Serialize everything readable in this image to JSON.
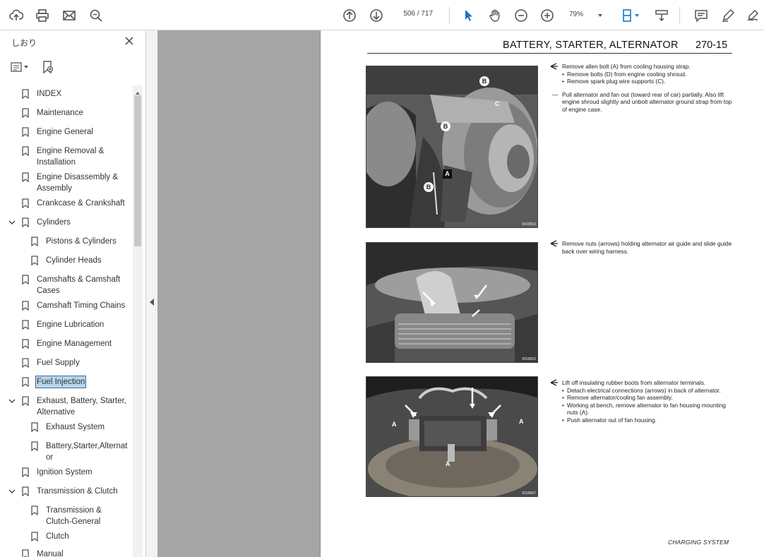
{
  "toolbar": {
    "current_page": "506",
    "total_pages": "/ 717",
    "zoom": "79%"
  },
  "sidebar": {
    "title": "しおり",
    "items": [
      {
        "label": "INDEX"
      },
      {
        "label": "Maintenance"
      },
      {
        "label": "Engine General"
      },
      {
        "label": "Engine Removal &"
      },
      {
        "label": "Installation"
      },
      {
        "label": "Engine Disassembly &"
      },
      {
        "label": "Assembly"
      },
      {
        "label": "Crankcase & Crankshaft"
      },
      {
        "label": "Cylinders"
      },
      {
        "label": "Pistons & Cylinders"
      },
      {
        "label": "Cylinder Heads"
      },
      {
        "label": "Camshafts & Camshaft"
      },
      {
        "label": "Cases"
      },
      {
        "label": "Camshaft Timing Chains"
      },
      {
        "label": "Engine Lubrication"
      },
      {
        "label": "Engine Management"
      },
      {
        "label": "Fuel Supply"
      },
      {
        "label": "Fuel Injection"
      },
      {
        "label": "Exhaust, Battery, Starter,"
      },
      {
        "label": "Alternative"
      },
      {
        "label": "Exhaust System"
      },
      {
        "label": "Battery,Starter,Alternat"
      },
      {
        "label": "or"
      },
      {
        "label": "Ignition System"
      },
      {
        "label": "Transmission & Clutch"
      },
      {
        "label": "Transmission &"
      },
      {
        "label": "Clutch-General"
      },
      {
        "label": "Clutch"
      },
      {
        "label": "Manual"
      }
    ]
  },
  "page": {
    "header_title": "BATTERY, STARTER, ALTERNATOR",
    "header_number": "270-15",
    "photo_codes": [
      "0018503",
      "0018502",
      "0018507"
    ],
    "photo1_labels": [
      "B",
      "B",
      "C",
      "A",
      "B"
    ],
    "photo3_labels": [
      "A",
      "A",
      "A"
    ],
    "block1": {
      "step": "Remove allen bolt (A) from cooling housing strap.",
      "bullets": [
        "Remove bolts (D) from engine cooling shroud.",
        "Remove spark plug wire supports (C)."
      ],
      "dash_step": "Pull alternator and fan out (toward rear of car) partially. Also lift engine shroud slightly and unbolt alternator ground strap from top of engine case."
    },
    "block2": {
      "step": "Remove nuts (arrows) holding alternator air guide and slide guide back over wiring harness."
    },
    "block3": {
      "step": "Lift off insulating rubber boots from alternator terminals.",
      "bullets": [
        "Detach electrical connections (arrows) in back of alternator.",
        "Remove alternator/cooling fan assembly.",
        "Working at bench, remove alternator to fan housing mounting nuts (A).",
        "Push alternator out of fan housing."
      ]
    },
    "footer": "CHARGING SYSTEM"
  }
}
